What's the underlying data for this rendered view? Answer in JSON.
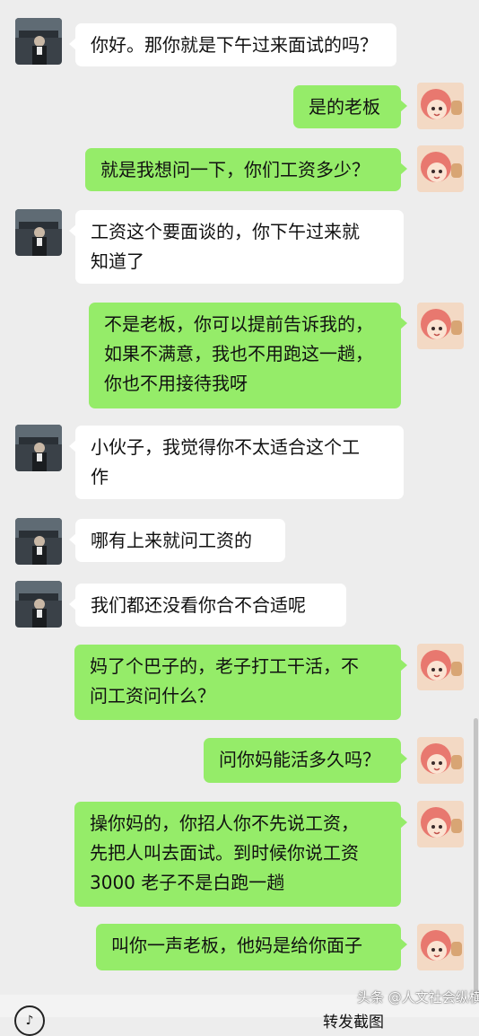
{
  "messages": [
    {
      "side": "left",
      "text": "你好。那你就是下午过来面试的吗？"
    },
    {
      "side": "right",
      "text": "是的老板"
    },
    {
      "side": "right",
      "text": "就是我想问一下，你们工资多少？"
    },
    {
      "side": "left",
      "text": "工资这个要面谈的，你下午过来就\n知道了"
    },
    {
      "side": "right",
      "text": "不是老板，你可以提前告诉我的，\n如果不满意，我也不用跑这一趟，\n你也不用接待我呀"
    },
    {
      "side": "left",
      "text": "小伙子，我觉得你不太适合这个工\n作"
    },
    {
      "side": "left",
      "text": "哪有上来就问工资的"
    },
    {
      "side": "left",
      "text": "我们都还没看你合不合适呢"
    },
    {
      "side": "right",
      "text": "妈了个巴子的，老子打工干活，不\n问工资问什么？"
    },
    {
      "side": "right",
      "text": "问你妈能活多久吗？"
    },
    {
      "side": "right",
      "text": "操你妈的，你招人你不先说工资，\n先把人叫去面试。到时候你说工资\n3000 老子不是白跑一趟"
    },
    {
      "side": "right",
      "text": "叫你一声老板，他妈是给你面子"
    }
  ],
  "bottom": {
    "circle_label": "♪",
    "forward_label": "转发截图"
  },
  "watermark": "头条 @人文社会纵横",
  "icons": {
    "left_avatar": "boss-photo-avatar",
    "right_avatar": "cartoon-girl-avatar"
  },
  "colors": {
    "background": "#ededed",
    "self_bubble": "#95ec69",
    "other_bubble": "#ffffff"
  }
}
